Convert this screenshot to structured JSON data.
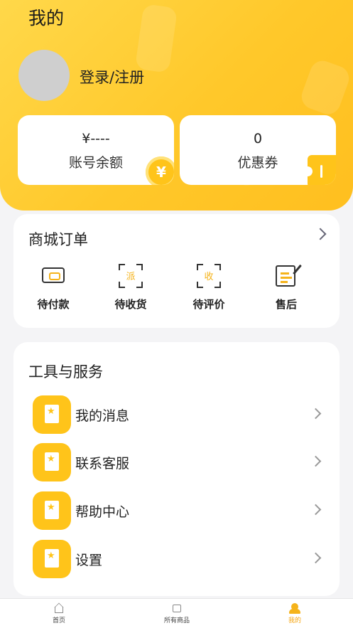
{
  "header": {
    "title": "我的",
    "login_label": "登录/注册"
  },
  "balance_card": {
    "value": "¥----",
    "label": "账号余额",
    "coin_symbol": "¥"
  },
  "coupon_card": {
    "value": "0",
    "label": "优惠券"
  },
  "orders": {
    "title": "商城订单",
    "items": [
      {
        "label": "待付款",
        "icon": "wallet-icon"
      },
      {
        "label": "待收货",
        "icon": "deliver-icon",
        "glyph": "派"
      },
      {
        "label": "待评价",
        "icon": "review-icon",
        "glyph": "收"
      },
      {
        "label": "售后",
        "icon": "after-sale-icon"
      }
    ]
  },
  "services": {
    "title": "工具与服务",
    "items": [
      {
        "label": "我的消息"
      },
      {
        "label": "联系客服"
      },
      {
        "label": "帮助中心"
      },
      {
        "label": "设置"
      }
    ]
  },
  "tabbar": {
    "tabs": [
      {
        "label": "首页",
        "icon": "home-icon",
        "active": false
      },
      {
        "label": "所有商品",
        "icon": "bag-icon",
        "active": false
      },
      {
        "label": "我的",
        "icon": "user-icon",
        "active": true
      }
    ]
  },
  "colors": {
    "accent": "#ffc41a",
    "header_gradient_start": "#ffd84a",
    "active_tab": "#f5a40f"
  }
}
